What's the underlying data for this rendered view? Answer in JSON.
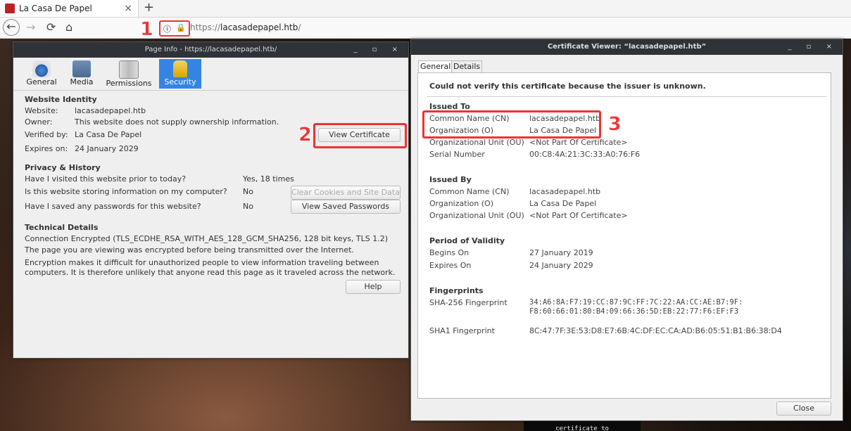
{
  "browser": {
    "tab_title": "La Casa De Papel",
    "tab_close": "×",
    "new_tab": "+",
    "url_scheme": "https://",
    "url_host": "lacasadepapel.htb",
    "url_rest": "/",
    "back_icon": "←",
    "forward_icon": "→",
    "reload_icon": "⟳",
    "home_icon": "⌂"
  },
  "annotations": {
    "n1": "1",
    "n2": "2",
    "n3": "3"
  },
  "page_info": {
    "title": "Page Info - https://lacasadepapel.htb/",
    "ctrls": "_ ▫ ×",
    "tabs": [
      "General",
      "Media",
      "Permissions",
      "Security"
    ],
    "website_identity": {
      "heading": "Website Identity",
      "website_label": "Website:",
      "website_value": "lacasadepapel.htb",
      "owner_label": "Owner:",
      "owner_value": "This website does not supply ownership information.",
      "verified_label": "Verified by:",
      "verified_value": "La Casa De Papel",
      "expires_label": "Expires on:",
      "expires_value": "24 January 2029",
      "view_cert_button": "View Certificate"
    },
    "privacy": {
      "heading": "Privacy & History",
      "q1": "Have I visited this website prior to today?",
      "a1": "Yes, 18 times",
      "q2": "Is this website storing information on my computer?",
      "a2": "No",
      "clear_button": "Clear Cookies and Site Data",
      "q3": "Have I saved any passwords for this website?",
      "a3": "No",
      "view_pw_button": "View Saved Passwords"
    },
    "technical": {
      "heading": "Technical Details",
      "line1": "Connection Encrypted (TLS_ECDHE_RSA_WITH_AES_128_GCM_SHA256, 128 bit keys, TLS 1.2)",
      "line2": "The page you are viewing was encrypted before being transmitted over the Internet.",
      "line3": "Encryption makes it difficult for unauthorized people to view information traveling between",
      "line4": "computers. It is therefore unlikely that anyone read this page as it traveled across the network.",
      "help_button": "Help"
    }
  },
  "cert_viewer": {
    "title": "Certificate Viewer: “lacasadepapel.htb”",
    "ctrls": "_ ▫ ×",
    "tabs": [
      "General",
      "Details"
    ],
    "warning": "Could not verify this certificate because the issuer is unknown.",
    "issued_to": {
      "heading": "Issued To",
      "cn_label": "Common Name (CN)",
      "cn": "lacasadepapel.htb",
      "o_label": "Organization (O)",
      "o": "La Casa De Papel",
      "ou_label": "Organizational Unit (OU)",
      "ou": "<Not Part Of Certificate>",
      "serial_label": "Serial Number",
      "serial": "00:C8:4A:21:3C:33:A0:76:F6"
    },
    "issued_by": {
      "heading": "Issued By",
      "cn_label": "Common Name (CN)",
      "cn": "lacasadepapel.htb",
      "o_label": "Organization (O)",
      "o": "La Casa De Papel",
      "ou_label": "Organizational Unit (OU)",
      "ou": "<Not Part Of Certificate>"
    },
    "validity": {
      "heading": "Period of Validity",
      "begins_label": "Begins On",
      "begins": "27 January 2019",
      "expires_label": "Expires On",
      "expires": "24 January 2029"
    },
    "fingerprints": {
      "heading": "Fingerprints",
      "sha256_label": "SHA-256 Fingerprint",
      "sha256_line1": "34:A6:8A:F7:19:CC:87:9C:FF:7C:22:AA:CC:AE:B7:9F:",
      "sha256_line2": "F8:60:66:01:80:B4:09:66:36:5D:EB:22:77:F6:EF:F3",
      "sha1_label": "SHA1 Fingerprint",
      "sha1": "8C:47:7F:3E:53:D8:E7:6B:4C:DF:EC:CA:AD:B6:05:51:B1:B6:38:D4"
    },
    "close_button": "Close"
  },
  "background_text": "certificate to"
}
